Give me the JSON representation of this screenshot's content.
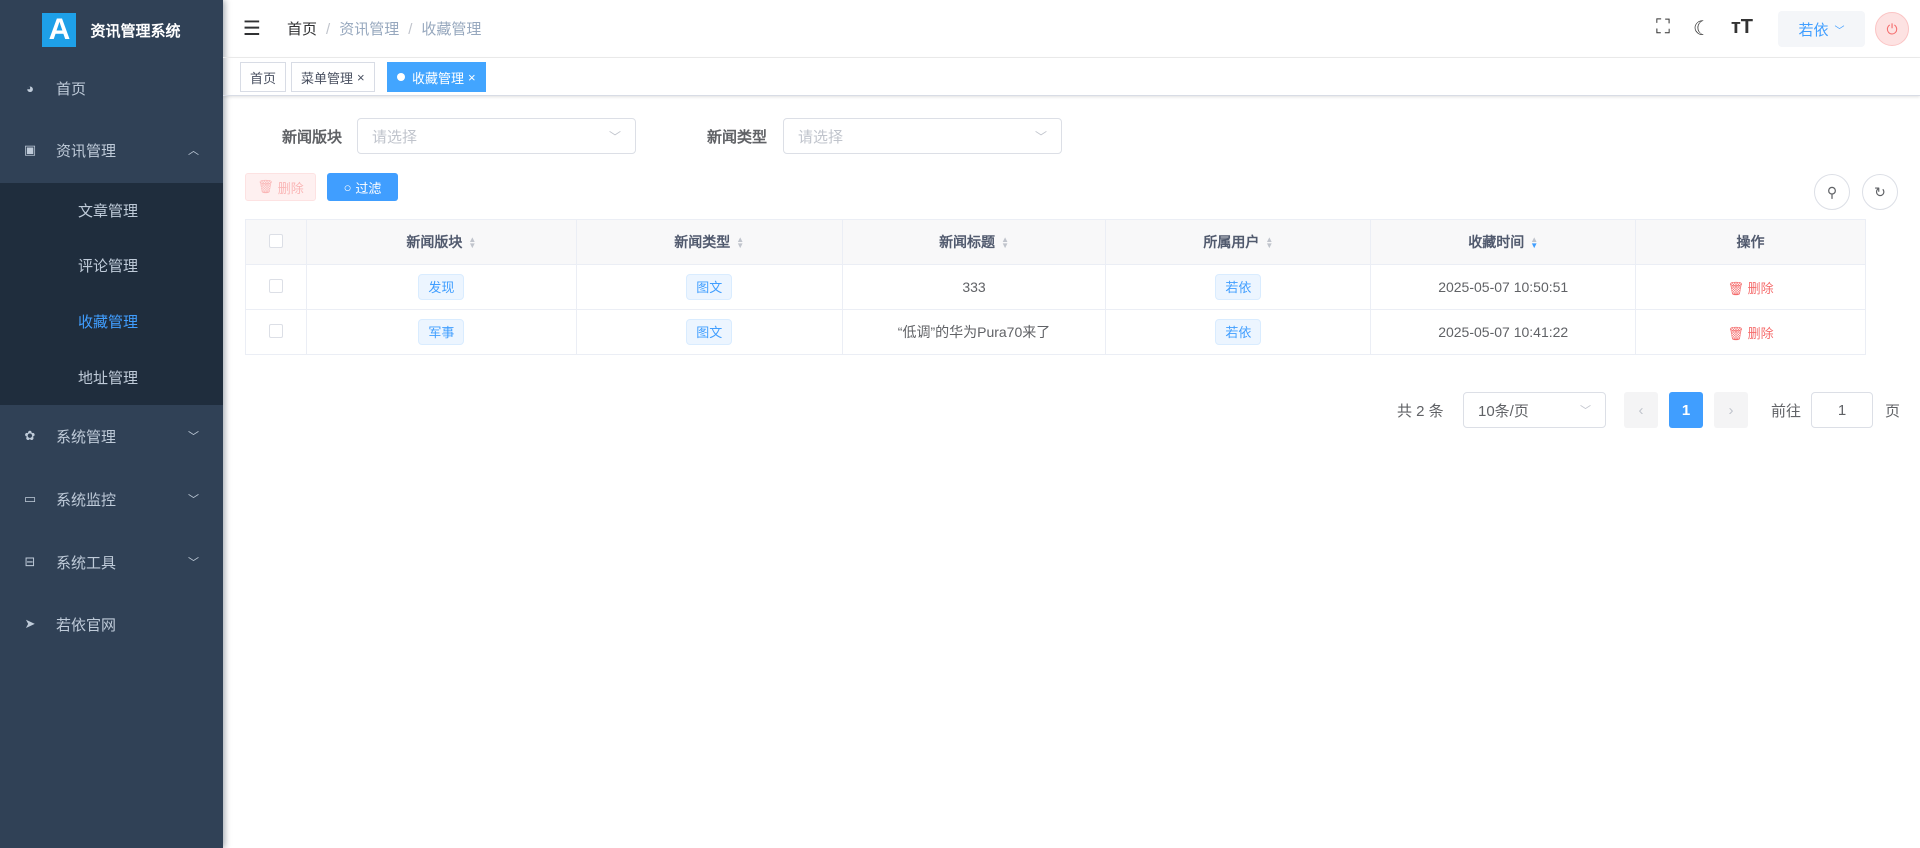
{
  "app": {
    "title": "资讯管理系统",
    "logo_letter": "A"
  },
  "sidebar": {
    "items": [
      {
        "label": "首页",
        "icon": "dashboard-icon"
      },
      {
        "label": "资讯管理",
        "icon": "news-icon",
        "expanded": true,
        "children": [
          {
            "label": "文章管理"
          },
          {
            "label": "评论管理"
          },
          {
            "label": "收藏管理",
            "active": true
          },
          {
            "label": "地址管理"
          }
        ]
      },
      {
        "label": "系统管理",
        "icon": "gear-icon"
      },
      {
        "label": "系统监控",
        "icon": "monitor-icon"
      },
      {
        "label": "系统工具",
        "icon": "toolbox-icon"
      },
      {
        "label": "若依官网",
        "icon": "paper-plane-icon"
      }
    ]
  },
  "header": {
    "breadcrumb": [
      "首页",
      "资讯管理",
      "收藏管理"
    ],
    "user": "若依"
  },
  "tags": [
    {
      "label": "首页"
    },
    {
      "label": "菜单管理"
    },
    {
      "label": "收藏管理",
      "active": true
    }
  ],
  "filters": [
    {
      "label": "新闻版块",
      "placeholder": "请选择"
    },
    {
      "label": "新闻类型",
      "placeholder": "请选择"
    }
  ],
  "toolbar": {
    "delete_label": "删除",
    "filter_label": "过滤"
  },
  "table": {
    "columns": [
      "新闻版块",
      "新闻类型",
      "新闻标题",
      "所属用户",
      "收藏时间",
      "操作"
    ],
    "rows": [
      {
        "section": "发现",
        "type": "图文",
        "title": "333",
        "user": "若依",
        "time": "2025-05-07 10:50:51",
        "action": "删除"
      },
      {
        "section": "军事",
        "type": "图文",
        "title": "“低调”的华为Pura70来了",
        "user": "若依",
        "time": "2025-05-07 10:41:22",
        "action": "删除"
      }
    ]
  },
  "pagination": {
    "total": "共 2 条",
    "page_size": "10条/页",
    "current": "1",
    "goto_label": "前往",
    "goto_value": "1",
    "page_suffix": "页"
  },
  "colors": {
    "sidebar": "#304156",
    "accent": "#409eff",
    "danger": "#f56c6c"
  }
}
